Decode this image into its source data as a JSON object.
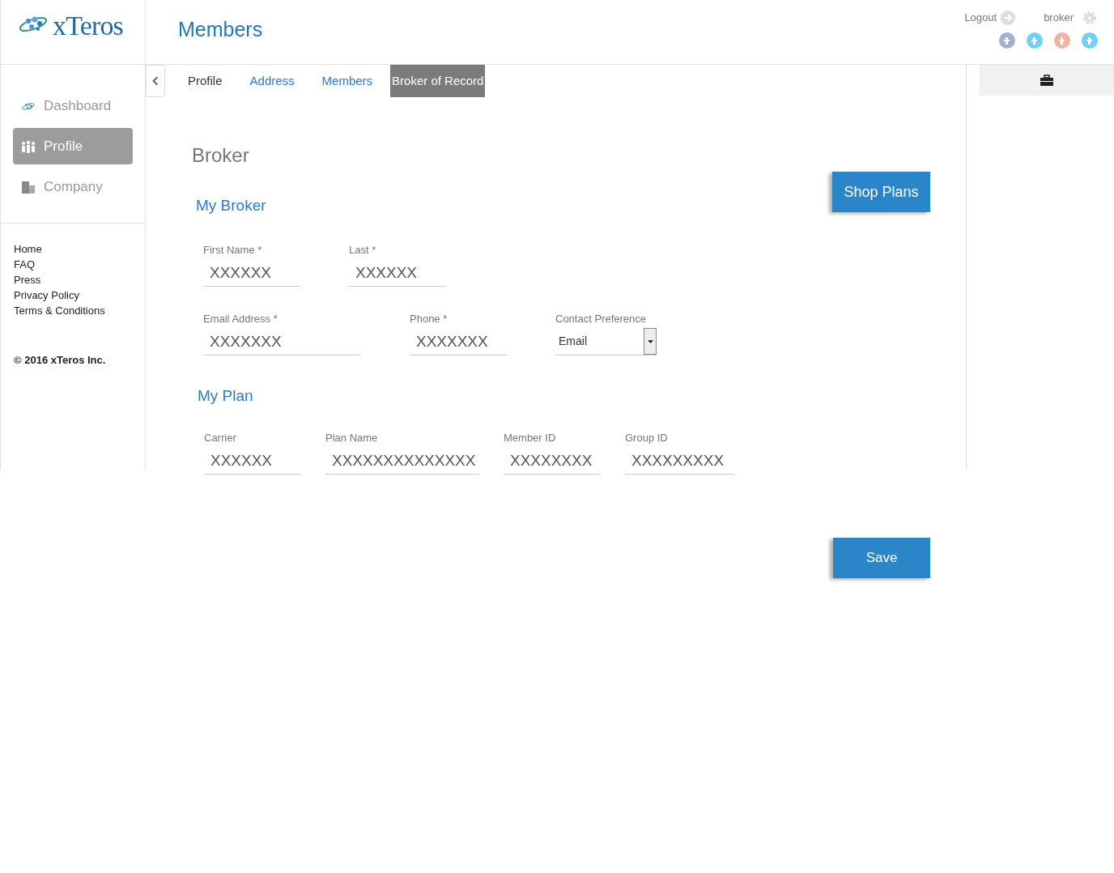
{
  "header": {
    "logo": "xTeros",
    "title": "Members",
    "logout": "Logout",
    "user": "broker"
  },
  "sidebar": {
    "items": [
      {
        "label": "Dashboard",
        "selected": false
      },
      {
        "label": "Profile",
        "selected": true
      },
      {
        "label": "Company",
        "selected": false
      }
    ],
    "links": [
      "Home",
      "FAQ",
      "Press",
      "Privacy Policy",
      "Terms & Conditions"
    ],
    "copyright": "© 2016 xTeros Inc."
  },
  "tabs": [
    {
      "label": "Profile",
      "visited": true,
      "selected": false
    },
    {
      "label": "Address",
      "visited": false,
      "selected": false
    },
    {
      "label": "Members",
      "visited": false,
      "selected": false
    },
    {
      "label": "Broker of Record",
      "visited": false,
      "selected": true
    }
  ],
  "page_heading": "Broker",
  "shop_button": "Shop Plans",
  "my_broker": {
    "heading": "My Broker",
    "rows": [
      [
        {
          "label": "First Name *",
          "value": "XXXXXX",
          "kind": "text"
        },
        {
          "label": "Last *",
          "value": "XXXXXX",
          "kind": "text"
        }
      ],
      [
        {
          "label": "Email Address *",
          "value": "XXXXXXX",
          "kind": "wide"
        },
        {
          "label": "Phone *",
          "value": "XXXXXXX",
          "kind": "text"
        },
        {
          "label": "Contact Preference",
          "value": "Email",
          "kind": "select"
        }
      ]
    ]
  },
  "my_plan": {
    "heading": "My Plan",
    "fields": [
      {
        "label": "Carrier",
        "value": "XXXXXX"
      },
      {
        "label": "Plan Name",
        "value": "XXXXXXXXXXXXXX"
      },
      {
        "label": "Member ID",
        "value": "XXXXXXXX"
      },
      {
        "label": "Group ID",
        "value": "XXXXXXXXX"
      }
    ]
  },
  "save_button": "Save"
}
